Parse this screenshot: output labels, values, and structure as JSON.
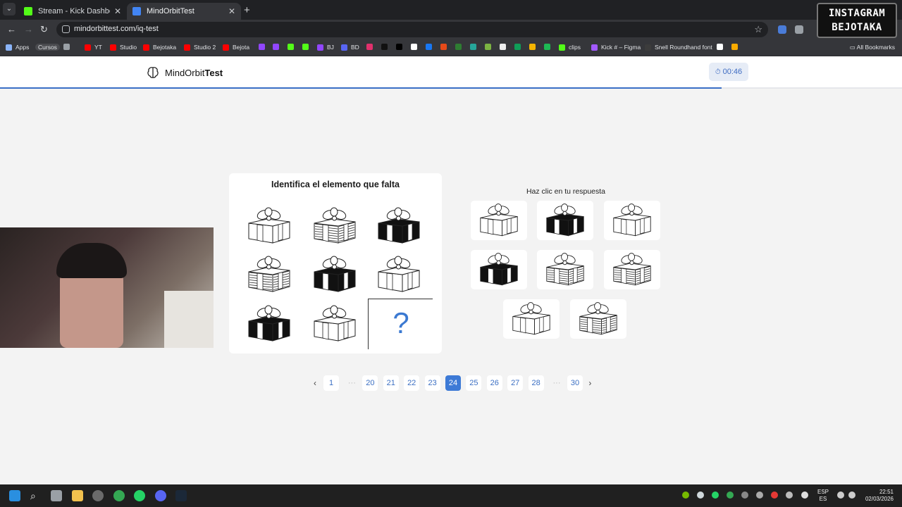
{
  "browser": {
    "tabs": [
      {
        "title": "Stream - Kick Dashboard",
        "active": false,
        "favicon_color": "#53fc18"
      },
      {
        "title": "MindOrbitTest",
        "active": true,
        "favicon_color": "#4285f4"
      }
    ],
    "url": "mindorbittest.com/iq-test",
    "bookmarks": [
      {
        "label": "Apps",
        "color": "#8ab4f8"
      },
      {
        "label": "Cursos",
        "color": "#5f6368"
      },
      {
        "label": "YT",
        "color": "#ff0000"
      },
      {
        "label": "Studio",
        "color": "#ff0000"
      },
      {
        "label": "Bejotaka",
        "color": "#ff0000"
      },
      {
        "label": "Studio 2",
        "color": "#ff0000"
      },
      {
        "label": "Bejota",
        "color": "#ff0000"
      },
      {
        "label": "BJ",
        "color": "#9146ff"
      },
      {
        "label": "BD",
        "color": "#5865f2"
      },
      {
        "label": "clips",
        "color": "#53fc18"
      },
      {
        "label": "Kick # – Figma",
        "color": "#a259ff"
      },
      {
        "label": "Snell Roundhand font",
        "color": "#ffffff"
      }
    ],
    "all_bookmarks": "All Bookmarks"
  },
  "overlay": {
    "badge_line1": "INSTAGRAM",
    "badge_line2": "BEJOTAKA"
  },
  "site": {
    "brand_regular": "MindOrbit",
    "brand_bold": "Test",
    "timer": "00:46",
    "progress_fraction": 0.8
  },
  "question": {
    "title": "Identifica el elemento que falta",
    "missing_symbol": "?",
    "grid": [
      {
        "style": "outline"
      },
      {
        "style": "striped"
      },
      {
        "style": "black"
      },
      {
        "style": "striped"
      },
      {
        "style": "black"
      },
      {
        "style": "outline"
      },
      {
        "style": "black"
      },
      {
        "style": "outline"
      }
    ]
  },
  "answers": {
    "prompt": "Haz clic en tu respuesta",
    "options": [
      {
        "style": "outline"
      },
      {
        "style": "black"
      },
      {
        "style": "outline"
      },
      {
        "style": "black"
      },
      {
        "style": "striped"
      },
      {
        "style": "striped"
      },
      {
        "style": "outline"
      },
      {
        "style": "striped"
      }
    ]
  },
  "pagination": {
    "prev": "‹",
    "next": "›",
    "pages": [
      "1",
      "...",
      "20",
      "21",
      "22",
      "23",
      "24",
      "25",
      "26",
      "27",
      "28",
      "...",
      "30"
    ],
    "current": "24"
  },
  "taskbar": {
    "lang_line1": "ESP",
    "lang_line2": "ES",
    "time": "22:51",
    "date": "02/03/2026"
  }
}
